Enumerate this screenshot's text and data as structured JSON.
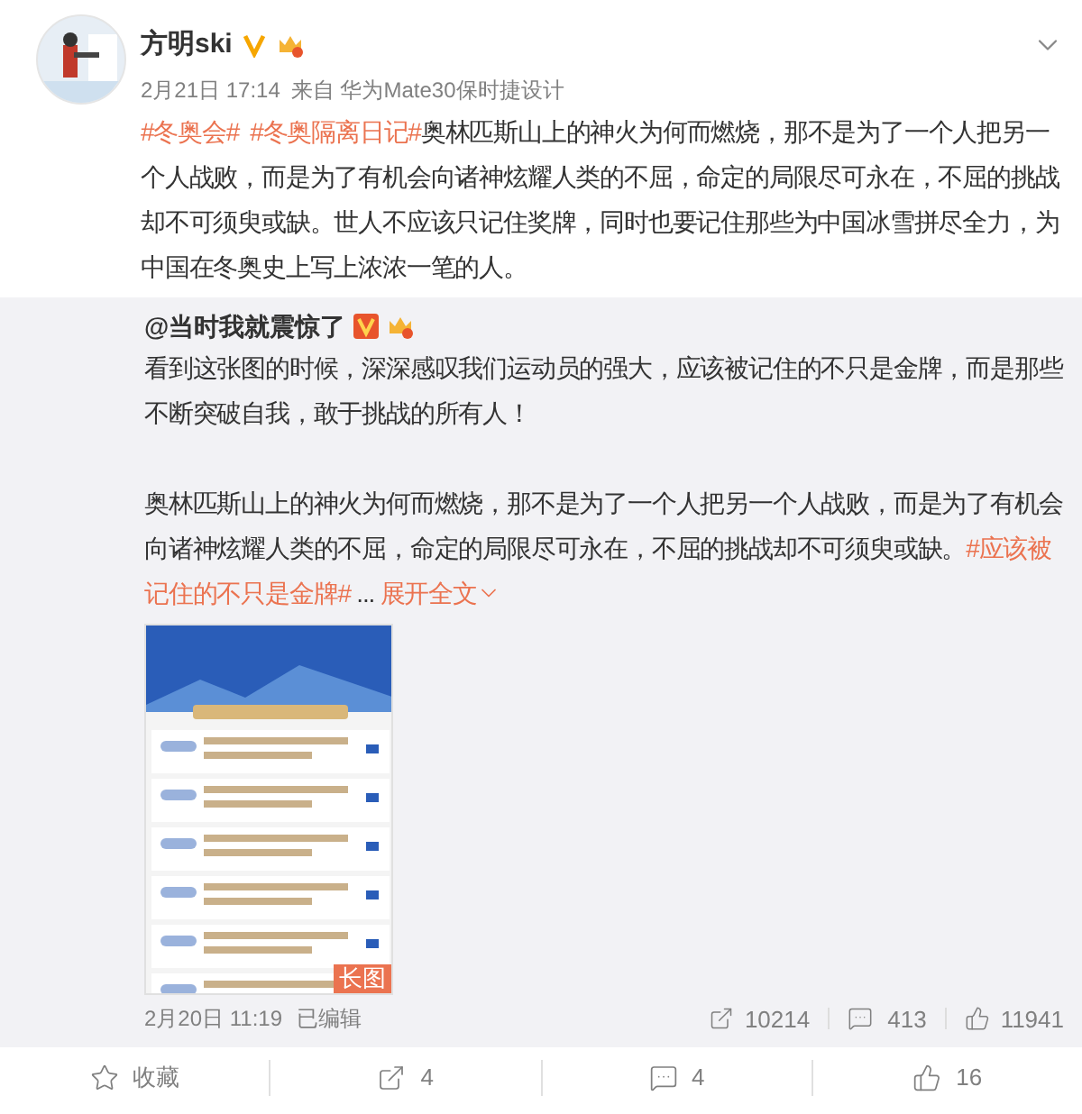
{
  "post": {
    "author": "方明ski",
    "time": "2月21日 17:14",
    "source": "来自 华为Mate30保时捷设计",
    "text_parts": [
      {
        "kind": "tag",
        "text": "#冬奥会#"
      },
      {
        "kind": "tag",
        "text": "#冬奥隔离日记#"
      },
      {
        "kind": "plain",
        "text": "奥林匹斯山上的神火为何而燃烧，那不是为了一个人把另一个人战败，而是为了有机会向诸神炫耀人类的不屈，命定的局限尽可永在，不屈的挑战却不可须臾或缺。世人不应该只记住奖牌，同时也要记住那些为中国冰雪拼尽全力，为中国在冬奥史上写上浓浓一笔的人。"
      }
    ]
  },
  "repost": {
    "author": "@当时我就震惊了",
    "paragraph_1": "看到这张图的时候，深深感叹我们运动员的强大，应该被记住的不只是金牌，而是那些不断突破自我，敢于挑战的所有人！",
    "paragraph_2_parts": [
      {
        "kind": "plain",
        "text": "奥林匹斯山上的神火为何而燃烧，那不是为了一个人把另一个人战败，而是为了有机会向诸神炫耀人类的不屈，命定的局限尽可永在，不屈的挑战却不可须臾或缺。"
      },
      {
        "kind": "tag",
        "text": "#应该被记住的不只是金牌#"
      },
      {
        "kind": "plain",
        "text": " ... "
      }
    ],
    "expand": "展开全文",
    "image": {
      "kind": "picture",
      "badge": "长图"
    },
    "time": "2月20日 11:19",
    "edited": "已编辑",
    "reposts": "10214",
    "comments": "413",
    "likes": "11941"
  },
  "actions": [
    {
      "kind": "favorite",
      "label": "收藏"
    },
    {
      "kind": "repost",
      "label": "4"
    },
    {
      "kind": "comment",
      "label": "4"
    },
    {
      "kind": "like",
      "label": "16"
    }
  ]
}
